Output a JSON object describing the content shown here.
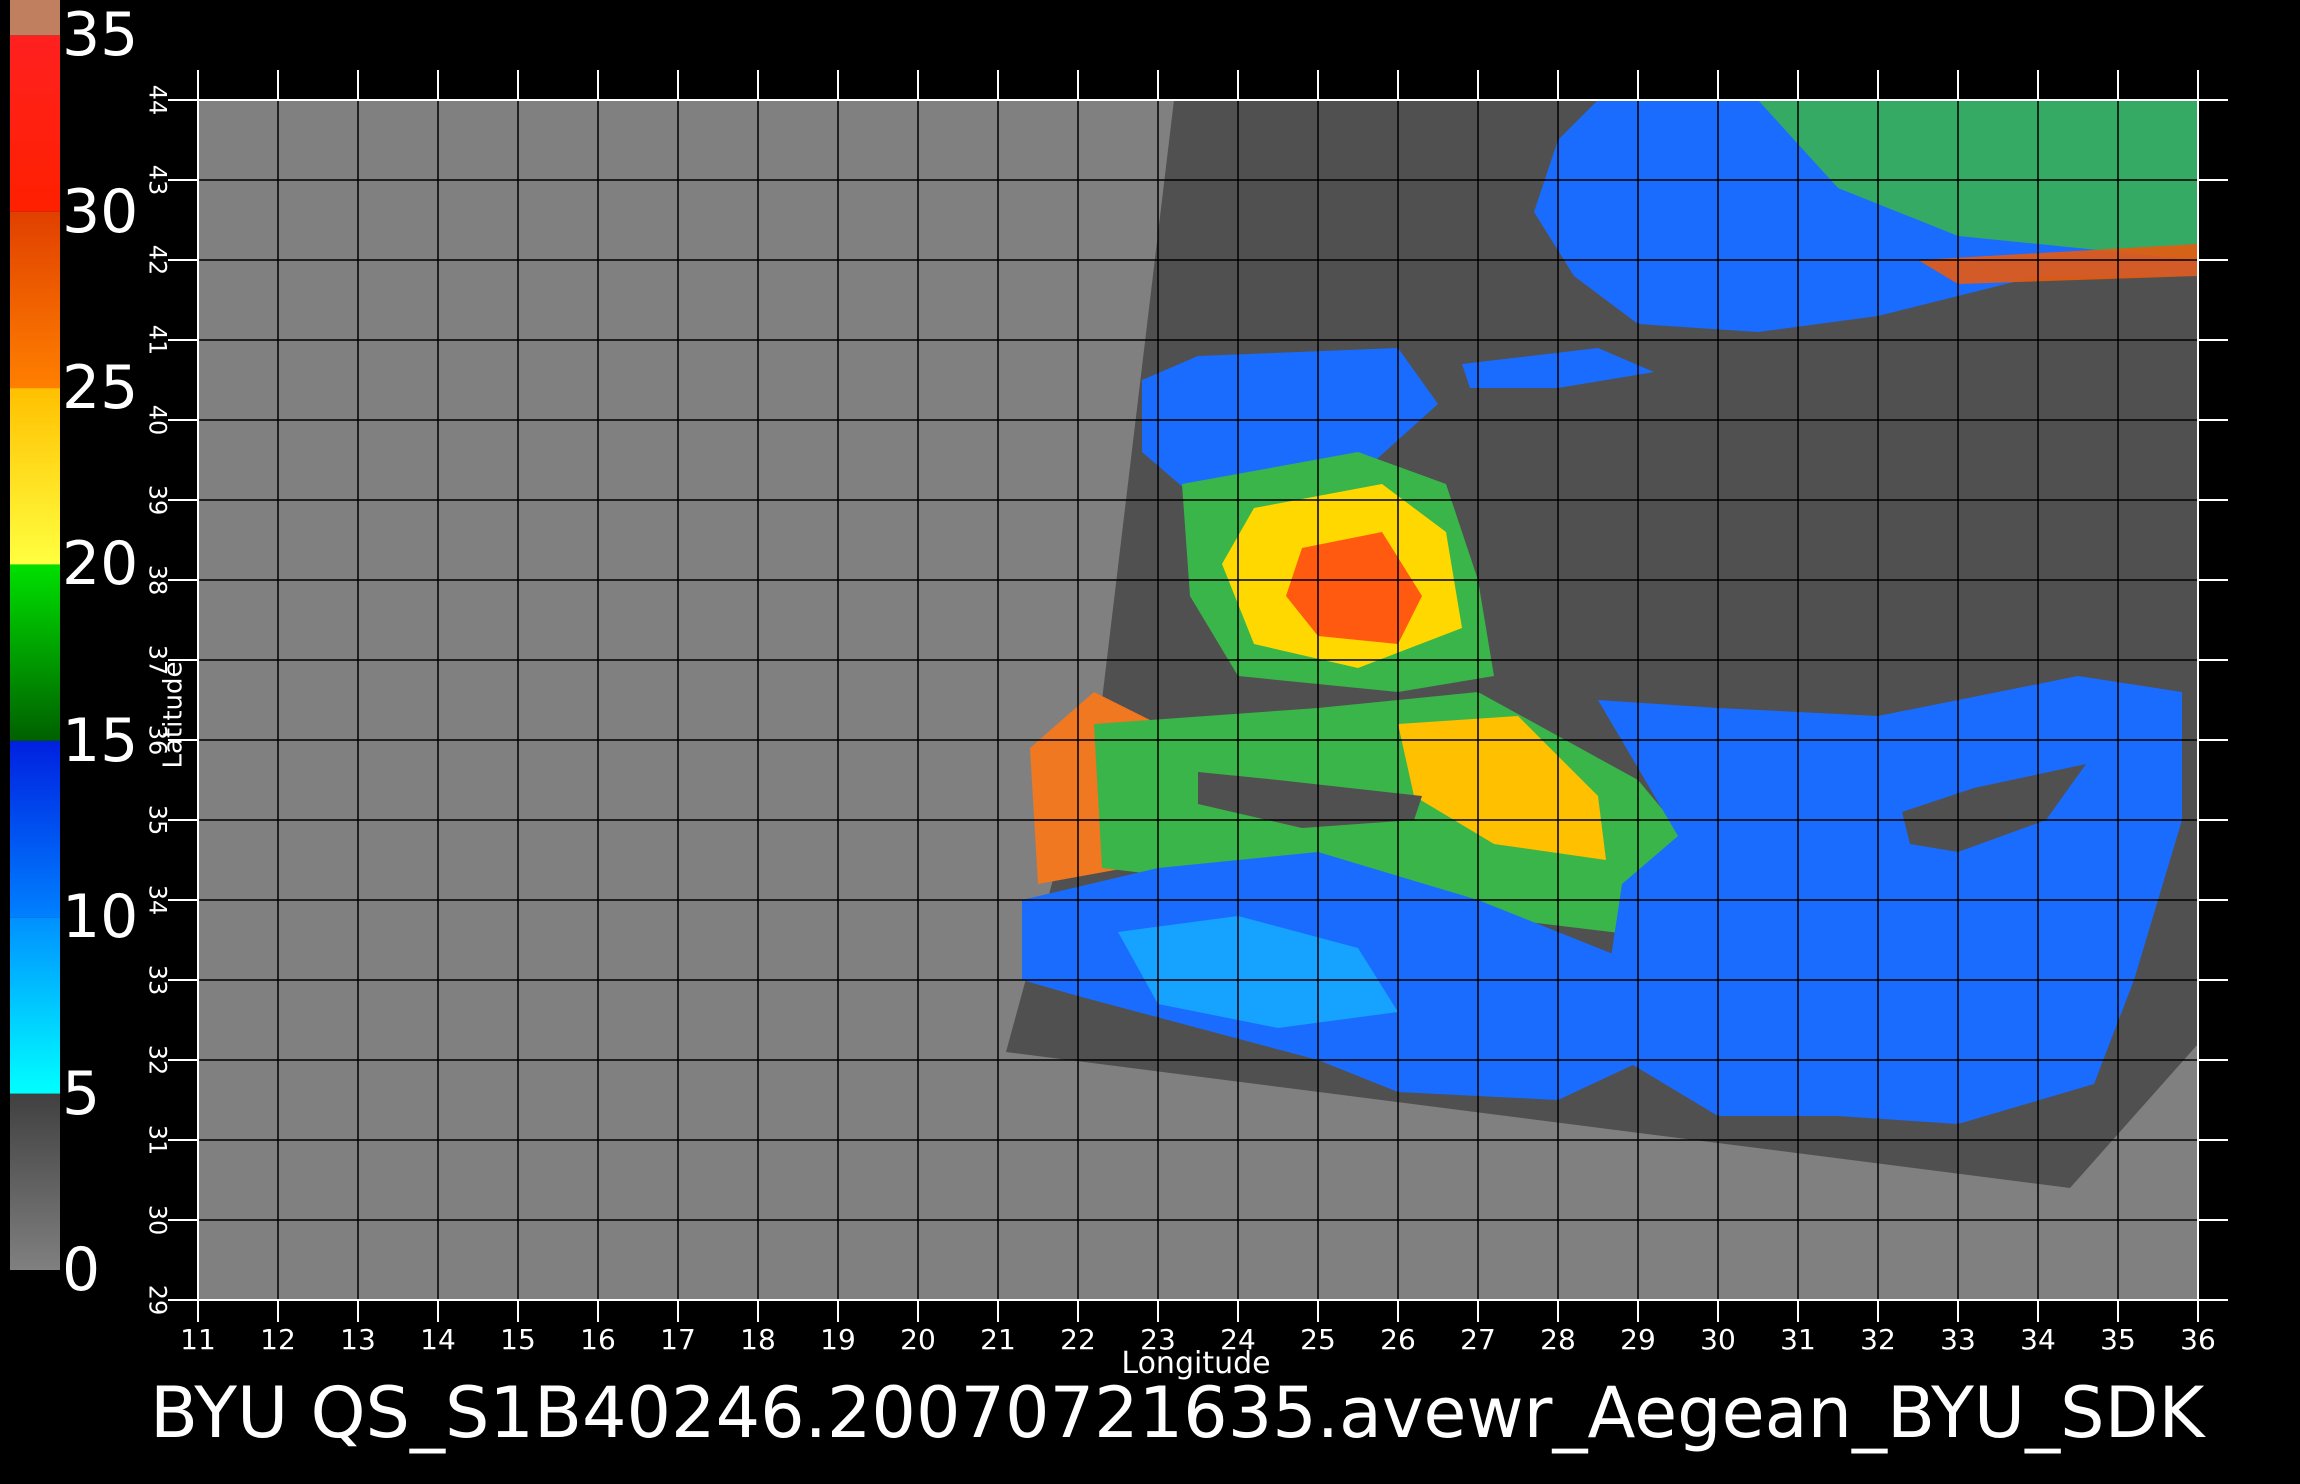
{
  "colors": {
    "background": "#000000",
    "land": "#808080",
    "swath": "#505050",
    "gridline": "#000000"
  },
  "legend": {
    "labels": [
      "35",
      "30",
      "25",
      "20",
      "15",
      "10",
      "5",
      "0"
    ],
    "bands": [
      {
        "from": 0,
        "to": 5,
        "colors": [
          "#808080",
          "#404040"
        ]
      },
      {
        "from": 5,
        "to": 10,
        "colors": [
          "#00ffff",
          "#0090ff"
        ]
      },
      {
        "from": 10,
        "to": 15,
        "colors": [
          "#0080ff",
          "#0020e0"
        ]
      },
      {
        "from": 15,
        "to": 20,
        "colors": [
          "#006000",
          "#00e000"
        ]
      },
      {
        "from": 20,
        "to": 25,
        "colors": [
          "#ffff40",
          "#ffc000"
        ]
      },
      {
        "from": 25,
        "to": 30,
        "colors": [
          "#ff8000",
          "#e04000"
        ]
      },
      {
        "from": 30,
        "to": 35,
        "colors": [
          "#ff2000",
          "#ff2020"
        ]
      },
      {
        "from": 35,
        "to": 36,
        "colors": [
          "#c08060",
          "#c08060"
        ]
      }
    ]
  },
  "map": {
    "lon_ticks": [
      "11",
      "12",
      "13",
      "14",
      "15",
      "16",
      "17",
      "18",
      "19",
      "20",
      "21",
      "22",
      "23",
      "24",
      "25",
      "26",
      "27",
      "28",
      "29",
      "30",
      "31",
      "32",
      "33",
      "34",
      "35",
      "36"
    ],
    "lat_ticks": [
      "29",
      "30",
      "31",
      "32",
      "33",
      "34",
      "35",
      "36",
      "37",
      "38",
      "39",
      "40",
      "41",
      "42",
      "43",
      "44"
    ],
    "lon_range": [
      11,
      36
    ],
    "lat_range": [
      29,
      44
    ],
    "xlabel": "Longitude",
    "ylabel": "Latitude"
  },
  "caption": "BYU  QS_S1B40246.20070721635.avewr_Aegean_BYU_SDK"
}
